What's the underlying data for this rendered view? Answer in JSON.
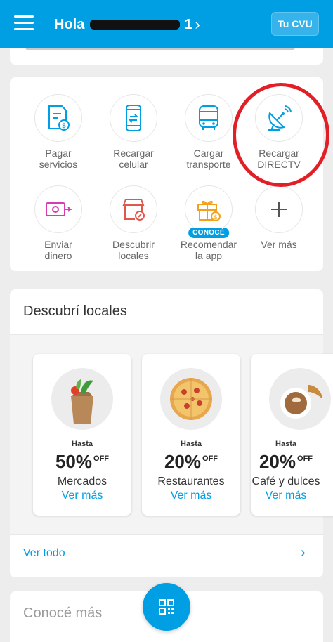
{
  "header": {
    "greeting": "Hola",
    "cvu_button": "Tu CVU"
  },
  "services": [
    {
      "label": "Pagar\nservicios",
      "icon": "bill-icon"
    },
    {
      "label": "Recargar\ncelular",
      "icon": "phone-recharge-icon"
    },
    {
      "label": "Cargar\ntransporte",
      "icon": "bus-icon"
    },
    {
      "label": "Recargar\nDIRECTV",
      "icon": "satellite-dish-icon"
    },
    {
      "label": "Enviar\ndinero",
      "icon": "send-money-icon"
    },
    {
      "label": "Descubrir\nlocales",
      "icon": "store-icon"
    },
    {
      "label": "Recomendar\nla app",
      "icon": "gift-icon",
      "badge": "CONOCÉ"
    },
    {
      "label": "Ver más",
      "icon": "plus-icon"
    }
  ],
  "locales": {
    "title": "Descubrí locales",
    "promos": [
      {
        "hasta": "Hasta",
        "pct": "50%",
        "off": "OFF",
        "category": "Mercados",
        "link": "Ver más"
      },
      {
        "hasta": "Hasta",
        "pct": "20%",
        "off": "OFF",
        "category": "Restaurantes",
        "link": "Ver más"
      },
      {
        "hasta": "Hasta",
        "pct": "20%",
        "off": "OFF",
        "category": "Café y dulces",
        "link": "Ver más"
      }
    ],
    "see_all": "Ver todo"
  },
  "conoce": {
    "title": "Conocé más"
  },
  "colors": {
    "brand_blue": "#009ee3",
    "highlight_red": "#e21f26"
  }
}
